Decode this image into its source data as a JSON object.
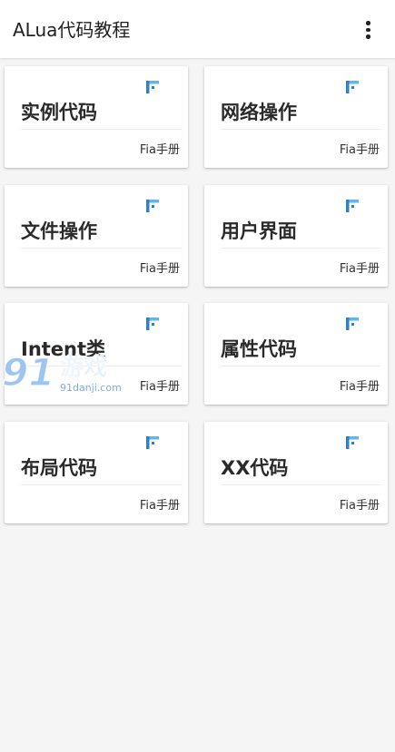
{
  "appbar": {
    "title": "ALua代码教程",
    "menu_icon": "more-vert-icon"
  },
  "cards": [
    {
      "title": "实例代码",
      "tag": "Fia手册",
      "icon": "fia-logo-icon"
    },
    {
      "title": "网络操作",
      "tag": "Fia手册",
      "icon": "fia-logo-icon"
    },
    {
      "title": "文件操作",
      "tag": "Fia手册",
      "icon": "fia-logo-icon"
    },
    {
      "title": "用户界面",
      "tag": "Fia手册",
      "icon": "fia-logo-icon"
    },
    {
      "title": "Intent类",
      "tag": "Fia手册",
      "icon": "fia-logo-icon"
    },
    {
      "title": "属性代码",
      "tag": "Fia手册",
      "icon": "fia-logo-icon"
    },
    {
      "title": "布局代码",
      "tag": "Fia手册",
      "icon": "fia-logo-icon"
    },
    {
      "title": "XX代码",
      "tag": "Fia手册",
      "icon": "fia-logo-icon"
    }
  ],
  "watermark": {
    "number": "91",
    "word": "游戏",
    "url": "91danji.com"
  },
  "colors": {
    "background": "#f5f5f5",
    "card": "#ffffff",
    "icon_blue": "#2f7fd2",
    "icon_light": "#5fb6ea"
  }
}
